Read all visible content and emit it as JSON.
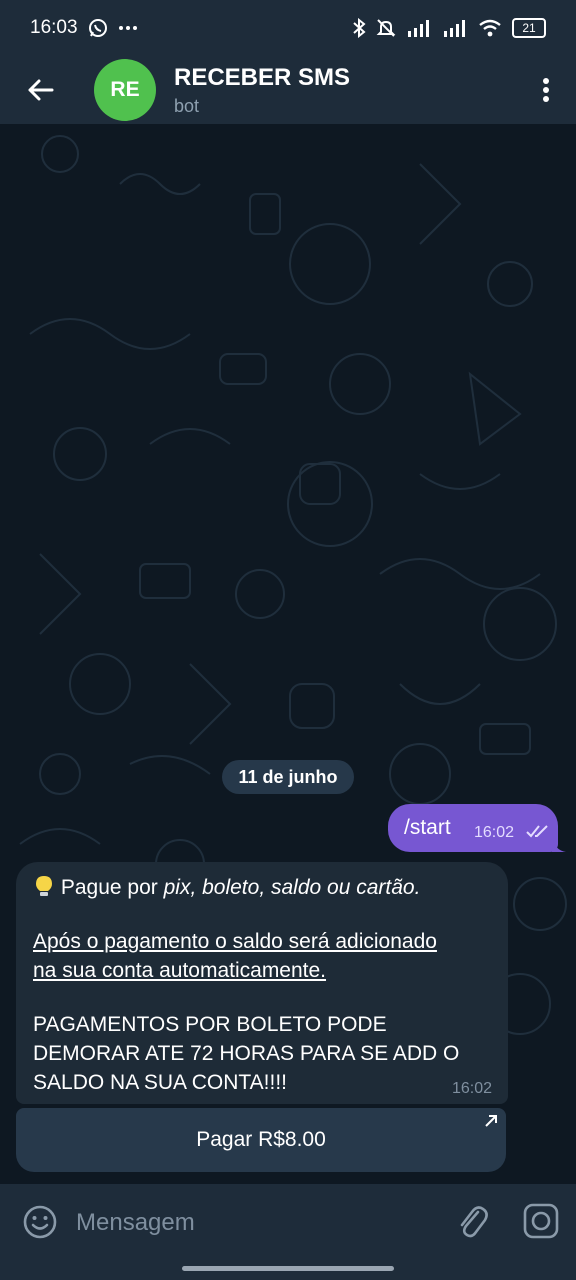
{
  "status_bar": {
    "time": "16:03",
    "battery": "21",
    "icons": [
      "whatsapp-icon",
      "more-dots-icon",
      "bluetooth-icon",
      "mute-icon",
      "signal-icon",
      "signal-icon",
      "wifi-icon",
      "battery-icon"
    ]
  },
  "header": {
    "avatar_initials": "RE",
    "avatar_color": "#50c14e",
    "title": "RECEBER SMS",
    "subtitle": "bot",
    "icons": [
      "back-arrow-icon",
      "more-vertical-icon"
    ]
  },
  "chat": {
    "date_label": "11 de junho",
    "outgoing": {
      "text": "/start",
      "time": "16:02",
      "status": "read",
      "color": "#7757d2"
    },
    "incoming": {
      "line1_prefix": "Pague por ",
      "line1_italic": "pix, boleto, saldo ou cartão.",
      "line2": "Após o pagamento o saldo será adicionado",
      "line3": "na sua conta automaticamente.",
      "line4": "PAGAMENTOS POR BOLETO PODE",
      "line5": "DEMORAR ATE 72 HORAS PARA SE ADD O",
      "line6": "SALDO NA SUA CONTA!!!!",
      "time": "16:02",
      "icon": "lightbulb-icon"
    },
    "inline_button": {
      "label": "Pagar R$8.00",
      "icon": "external-arrow-icon"
    }
  },
  "input_bar": {
    "placeholder": "Mensagem",
    "icons": [
      "emoji-icon",
      "attach-icon",
      "camera-icon"
    ]
  }
}
